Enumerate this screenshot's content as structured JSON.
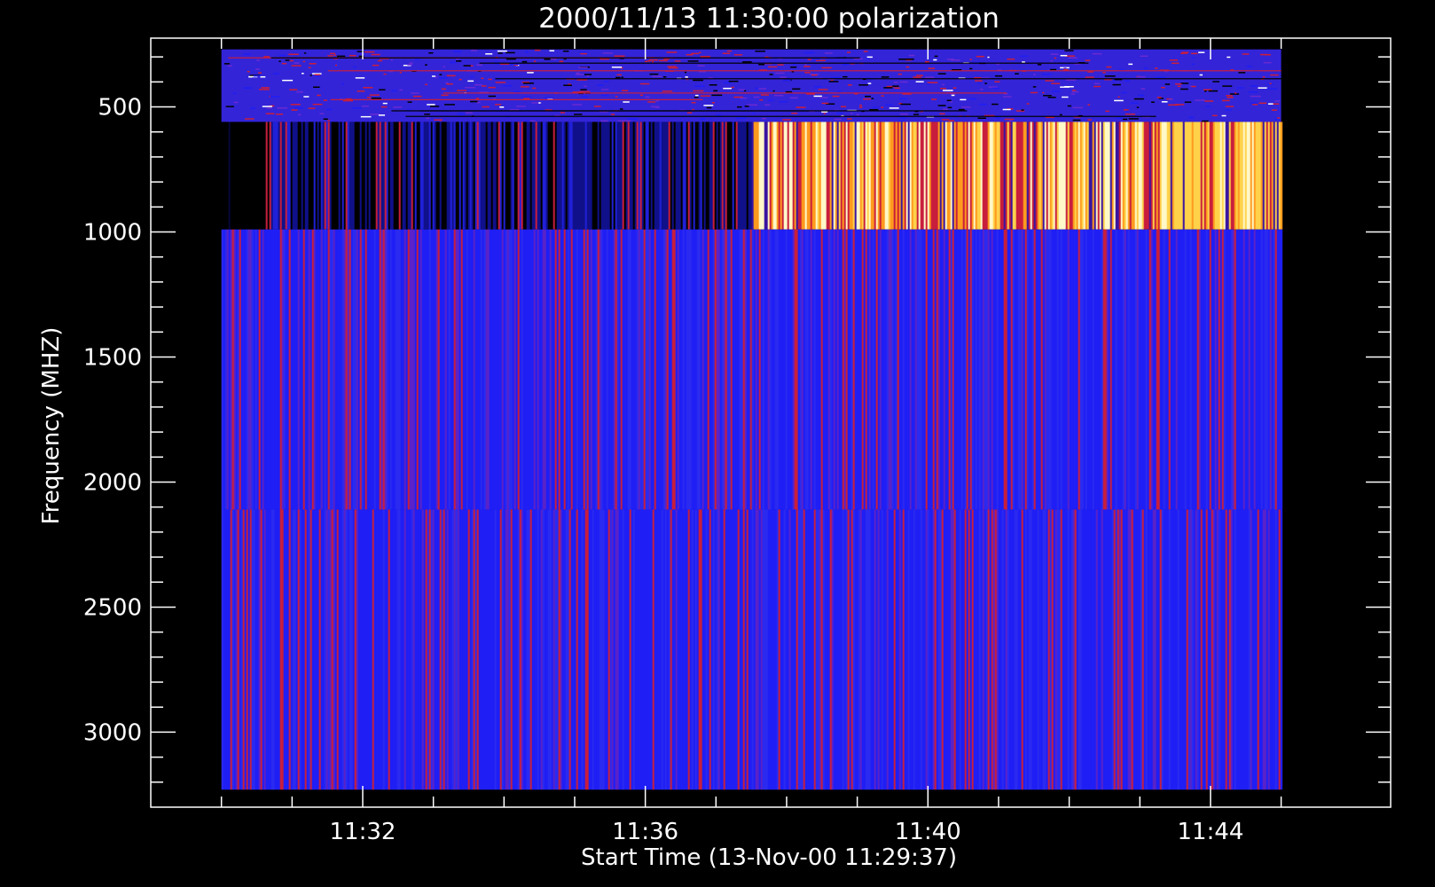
{
  "chart_data": {
    "type": "heatmap",
    "title": "2000/11/13 11:30:00 polarization",
    "xlabel": "Start Time (13-Nov-00 11:29:37)",
    "ylabel": "Frequency (MHZ)",
    "x_major_ticks": [
      "11:32",
      "11:36",
      "11:40",
      "11:44"
    ],
    "y_major_ticks": [
      500,
      1000,
      1500,
      2000,
      2500,
      3000
    ],
    "xlim": [
      "11:29:00",
      "11:46:33"
    ],
    "ylim": [
      3300,
      225
    ],
    "data_time_range": [
      "11:30:00",
      "11:45:00"
    ],
    "data_freq_range": [
      270,
      3230
    ],
    "bands": [
      {
        "freq_range": [
          270,
          560
        ],
        "description": "noisy mixed blue/red/white"
      },
      {
        "freq_range": [
          560,
          990
        ],
        "description": "black and dark blue before about 11:37:30, red/orange/yellow/white bursts after"
      },
      {
        "freq_range": [
          990,
          2110
        ],
        "description": "blue with faint red stripes"
      },
      {
        "freq_range": [
          2110,
          3230
        ],
        "description": "blue with faint red stripes"
      }
    ],
    "grid": false,
    "colors": {
      "background": "#000000",
      "low": "#1e1ef5",
      "mid": "#c81e3c",
      "high": "#ff9a1e",
      "peak": "#fff8c8"
    }
  }
}
